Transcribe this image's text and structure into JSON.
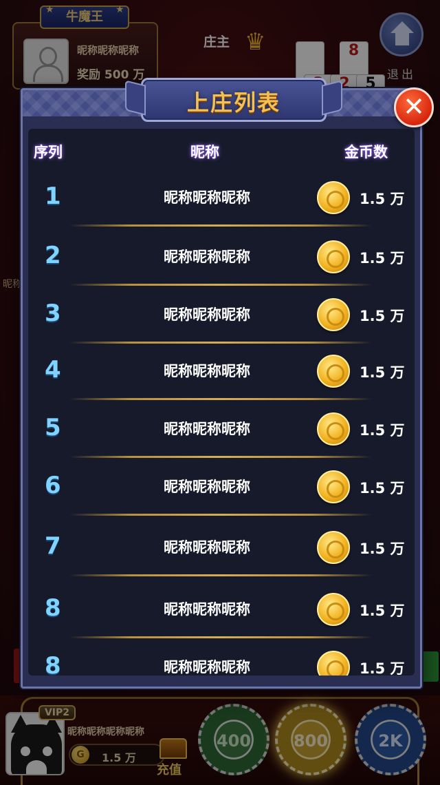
{
  "background": {
    "king_title": "牛魔王",
    "king_name": "昵称昵称昵称",
    "king_reward": "奖励 500 万",
    "banker_label": "庄主",
    "cards": [
      {
        "rank": "2",
        "suit": "♠",
        "color": "#111111"
      },
      {
        "rank": "8",
        "suit": "",
        "color": "#c0181b"
      },
      {
        "rank": "3",
        "suit": "",
        "color": "#c0181b"
      },
      {
        "rank": "2",
        "suit": "",
        "color": "#c0181b"
      },
      {
        "rank": "5",
        "suit": "",
        "color": "#111111"
      }
    ],
    "exit_label": "退出",
    "side_text": "昵称"
  },
  "modal": {
    "title": "上庄列表",
    "close_symbol": "✕",
    "headers": {
      "rank": "序列",
      "nickname": "昵称",
      "coins": "金币数"
    },
    "rows": [
      {
        "rank": "1",
        "nickname": "昵称昵称昵称",
        "coins": "1.5 万"
      },
      {
        "rank": "2",
        "nickname": "昵称昵称昵称",
        "coins": "1.5 万"
      },
      {
        "rank": "3",
        "nickname": "昵称昵称昵称",
        "coins": "1.5 万"
      },
      {
        "rank": "4",
        "nickname": "昵称昵称昵称",
        "coins": "1.5 万"
      },
      {
        "rank": "5",
        "nickname": "昵称昵称昵称",
        "coins": "1.5 万"
      },
      {
        "rank": "6",
        "nickname": "昵称昵称昵称",
        "coins": "1.5 万"
      },
      {
        "rank": "7",
        "nickname": "昵称昵称昵称",
        "coins": "1.5 万"
      },
      {
        "rank": "8",
        "nickname": "昵称昵称昵称",
        "coins": "1.5 万"
      },
      {
        "rank": "8",
        "nickname": "昵称昵称昵称",
        "coins": "1.5 万"
      }
    ]
  },
  "player": {
    "vip": "VIP2",
    "name": "昵称昵称昵称昵称",
    "gold": "1.5 万",
    "gold_icon": "G",
    "recharge_label": "充值"
  },
  "chips": [
    {
      "label": "400"
    },
    {
      "label": "800"
    },
    {
      "label": "2K"
    }
  ],
  "colors": {
    "title_gold": "#f3c153",
    "rank_blue": "#7fd3ff",
    "close_red": "#d7260d",
    "panel_bg": "#171a2b"
  }
}
